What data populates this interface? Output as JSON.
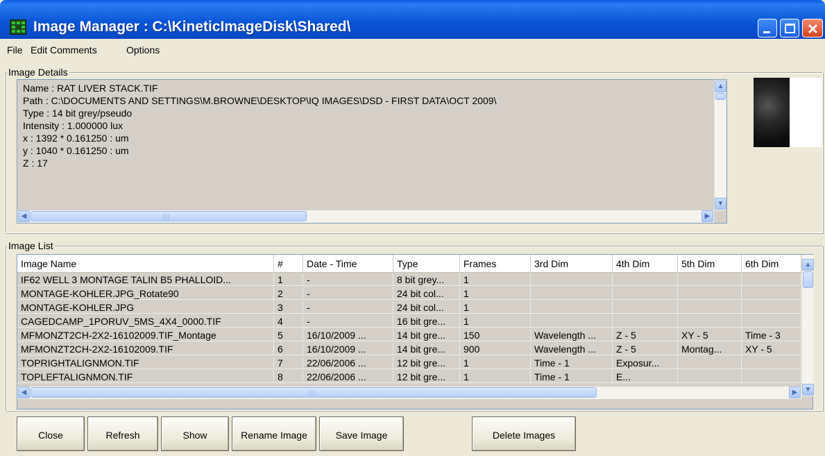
{
  "window": {
    "title": "Image Manager : C:\\KineticImageDisk\\Shared\\"
  },
  "menu": {
    "file": "File",
    "edit_comments": "Edit Comments",
    "options": "Options"
  },
  "details": {
    "group_label": "Image Details",
    "lines": [
      "Name : RAT LIVER STACK.TIF",
      "Path : C:\\DOCUMENTS AND SETTINGS\\M.BROWNE\\DESKTOP\\IQ IMAGES\\DSD - FIRST DATA\\OCT 2009\\",
      "Type : 14 bit grey/pseudo",
      "Intensity : 1.000000 lux",
      "x : 1392 * 0.161250 : um",
      "y : 1040 * 0.161250 : um",
      "Z : 17"
    ]
  },
  "list": {
    "group_label": "Image List",
    "columns": [
      "Image Name",
      "#",
      "Date - Time",
      "Type",
      "Frames",
      "3rd Dim",
      "4th Dim",
      "5th Dim",
      "6th Dim"
    ],
    "rows": [
      [
        "IF62 WELL 3 MONTAGE TALIN B5 PHALLOID...",
        "1",
        "-",
        "8 bit grey...",
        "1",
        "",
        "",
        "",
        ""
      ],
      [
        "MONTAGE-KOHLER.JPG_Rotate90",
        "2",
        "-",
        "24 bit col...",
        "1",
        "",
        "",
        "",
        ""
      ],
      [
        "MONTAGE-KOHLER.JPG",
        "3",
        "-",
        "24 bit col...",
        "1",
        "",
        "",
        "",
        ""
      ],
      [
        "CAGEDCAMP_1PORUV_5MS_4X4_0000.TIF",
        "4",
        "-",
        "16 bit gre...",
        "1",
        "",
        "",
        "",
        ""
      ],
      [
        "MFMONZT2CH-2X2-16102009.TIF_Montage",
        "5",
        "16/10/2009 ...",
        "14 bit gre...",
        "150",
        "Wavelength ...",
        "Z - 5",
        "XY - 5",
        "Time - 3"
      ],
      [
        "MFMONZT2CH-2X2-16102009.TIF",
        "6",
        "16/10/2009 ...",
        "14 bit gre...",
        "900",
        "Wavelength ...",
        "Z - 5",
        "Montag...",
        "XY - 5"
      ],
      [
        "TOPRIGHTALIGNMON.TIF",
        "7",
        "22/06/2006 ...",
        "12 bit gre...",
        "1",
        "Time - 1",
        "Exposur...",
        "",
        ""
      ],
      [
        "TOPLEFTALIGNMON.TIF",
        "8",
        "22/06/2006 ...",
        "12 bit gre...",
        "1",
        "Time - 1",
        "E...",
        "",
        ""
      ]
    ]
  },
  "buttons": {
    "close": "Close",
    "refresh": "Refresh",
    "show": "Show",
    "rename": "Rename Image",
    "save": "Save Image",
    "delete": "Delete Images"
  },
  "colors": {
    "title_bar": "#0a56d8",
    "window_bg": "#ece9d8",
    "list_bg": "#d4d0c8"
  },
  "icons": {
    "app": "image-manager-icon",
    "minimize": "minimize-icon",
    "maximize": "maximize-icon",
    "close": "close-icon"
  }
}
